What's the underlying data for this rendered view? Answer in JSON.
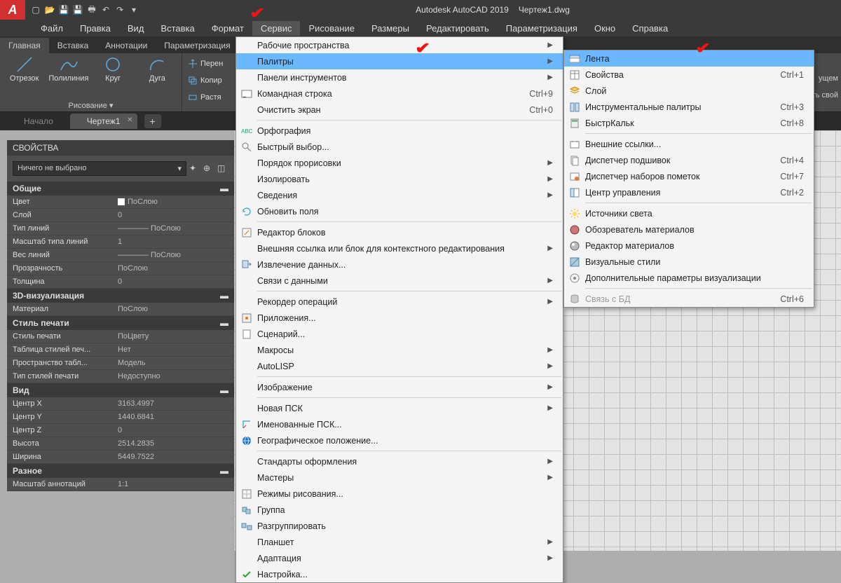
{
  "title": {
    "app": "Autodesk AutoCAD 2019",
    "doc": "Чертеж1.dwg",
    "logo": "A"
  },
  "menubar": [
    "Файл",
    "Правка",
    "Вид",
    "Вставка",
    "Формат",
    "Сервис",
    "Рисование",
    "Размеры",
    "Редактировать",
    "Параметризация",
    "Окно",
    "Справка"
  ],
  "ribbonTabs": [
    "Главная",
    "Вставка",
    "Аннотации",
    "Параметризация"
  ],
  "drawTools": {
    "items": [
      "Отрезок",
      "Полилиния",
      "Круг",
      "Дуга"
    ],
    "panel": "Рисование ▾"
  },
  "modify": [
    "Перен",
    "Копир",
    "Растя"
  ],
  "docTabs": {
    "inactive": "Начало",
    "active": "Чертеж1"
  },
  "props": {
    "title": "СВОЙСТВА",
    "selector": "Ничего не выбрано",
    "groups": [
      {
        "name": "Общие",
        "rows": [
          [
            "Цвет",
            "ПоСлою",
            true
          ],
          [
            "Слой",
            "0"
          ],
          [
            "Тип линий",
            "———— ПоСлою"
          ],
          [
            "Масштаб типа линий",
            "1"
          ],
          [
            "Вес линий",
            "———— ПоСлою"
          ],
          [
            "Прозрачность",
            "ПоСлою"
          ],
          [
            "Толщина",
            "0"
          ]
        ]
      },
      {
        "name": "3D-визуализация",
        "rows": [
          [
            "Материал",
            "ПоСлою"
          ]
        ]
      },
      {
        "name": "Стиль печати",
        "rows": [
          [
            "Стиль печати",
            "ПоЦвету"
          ],
          [
            "Таблица стилей печ...",
            "Нет"
          ],
          [
            "Пространство табл...",
            "Модель"
          ],
          [
            "Тип стилей печати",
            "Недоступно"
          ]
        ]
      },
      {
        "name": "Вид",
        "rows": [
          [
            "Центр X",
            "3163.4997"
          ],
          [
            "Центр Y",
            "1440.6841"
          ],
          [
            "Центр Z",
            "0"
          ],
          [
            "Высота",
            "2514.2835"
          ],
          [
            "Ширина",
            "5449.7522"
          ]
        ]
      },
      {
        "name": "Разное",
        "rows": [
          [
            "Масштаб аннотаций",
            "1:1"
          ]
        ]
      }
    ]
  },
  "menu1": [
    {
      "t": "Рабочие пространства",
      "arr": true
    },
    {
      "t": "Палитры",
      "arr": true,
      "hl": true
    },
    {
      "t": "Панели инструментов",
      "arr": true
    },
    {
      "t": "Командная строка",
      "sc": "Ctrl+9",
      "ico": "cmd"
    },
    {
      "t": "Очистить экран",
      "sc": "Ctrl+0"
    },
    {
      "sep": true
    },
    {
      "t": "Орфография",
      "ico": "abc"
    },
    {
      "t": "Быстрый выбор...",
      "ico": "qsel"
    },
    {
      "t": "Порядок прорисовки",
      "arr": true
    },
    {
      "t": "Изолировать",
      "arr": true
    },
    {
      "t": "Сведения",
      "arr": true
    },
    {
      "t": "Обновить поля",
      "ico": "refresh"
    },
    {
      "sep": true
    },
    {
      "t": "Редактор блоков",
      "ico": "bedit"
    },
    {
      "t": "Внешняя ссылка или блок для контекстного редактирования",
      "arr": true
    },
    {
      "t": "Извлечение данных...",
      "ico": "extract"
    },
    {
      "t": "Связи с данными",
      "arr": true
    },
    {
      "sep": true
    },
    {
      "t": "Рекордер операций",
      "arr": true
    },
    {
      "t": "Приложения...",
      "ico": "app"
    },
    {
      "t": "Сценарий...",
      "ico": "script"
    },
    {
      "t": "Макросы",
      "arr": true
    },
    {
      "t": "AutoLISP",
      "arr": true
    },
    {
      "sep": true
    },
    {
      "t": "Изображение",
      "arr": true
    },
    {
      "sep": true
    },
    {
      "t": "Новая ПСК",
      "arr": true
    },
    {
      "t": "Именованные ПСК...",
      "ico": "ucs"
    },
    {
      "t": "Географическое положение...",
      "ico": "geo"
    },
    {
      "sep": true
    },
    {
      "t": "Стандарты оформления",
      "arr": true
    },
    {
      "t": "Мастеры",
      "arr": true
    },
    {
      "t": "Режимы рисования...",
      "ico": "dmode"
    },
    {
      "t": "Группа",
      "ico": "group"
    },
    {
      "t": "Разгруппировать",
      "ico": "ungroup"
    },
    {
      "t": "Планшет",
      "arr": true
    },
    {
      "t": "Адаптация",
      "arr": true
    },
    {
      "t": "Настройка...",
      "ico": "check"
    }
  ],
  "menu2": [
    {
      "t": "Лента",
      "hl": true,
      "ico": "ribbon"
    },
    {
      "t": "Свойства",
      "sc": "Ctrl+1",
      "ico": "props"
    },
    {
      "t": "Слой",
      "ico": "layer"
    },
    {
      "t": "Инструментальные палитры",
      "sc": "Ctrl+3",
      "ico": "tpal"
    },
    {
      "t": "БыстрКальк",
      "sc": "Ctrl+8",
      "ico": "calc"
    },
    {
      "sep": true
    },
    {
      "t": "Внешние ссылки...",
      "ico": "xref"
    },
    {
      "t": "Диспетчер подшивок",
      "sc": "Ctrl+4",
      "ico": "ssm"
    },
    {
      "t": "Диспетчер наборов пометок",
      "sc": "Ctrl+7",
      "ico": "markup"
    },
    {
      "t": "Центр управления",
      "sc": "Ctrl+2",
      "ico": "dc"
    },
    {
      "sep": true
    },
    {
      "t": "Источники света",
      "ico": "light"
    },
    {
      "t": "Обозреватель материалов",
      "ico": "matb"
    },
    {
      "t": "Редактор материалов",
      "ico": "mate"
    },
    {
      "t": "Визуальные стили",
      "ico": "vs"
    },
    {
      "t": "Дополнительные параметры визуализации",
      "ico": "vadv"
    },
    {
      "sep": true
    },
    {
      "t": "Связь с БД",
      "sc": "Ctrl+6",
      "ico": "db",
      "dis": true
    }
  ],
  "partial": {
    "a": "ущем",
    "b": "ть свой"
  }
}
